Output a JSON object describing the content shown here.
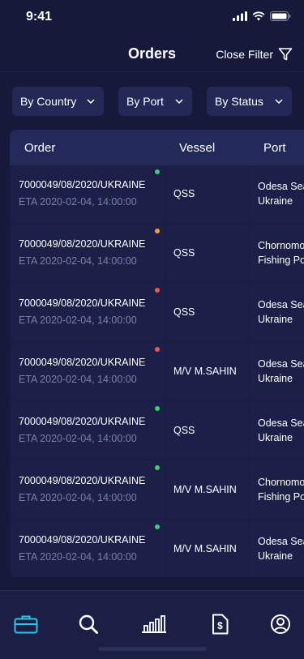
{
  "status_bar": {
    "time": "9:41"
  },
  "header": {
    "title": "Orders",
    "close_filter_label": "Close Filter"
  },
  "filters": [
    {
      "label": "By Country"
    },
    {
      "label": "By Port"
    },
    {
      "label": "By Status"
    }
  ],
  "table": {
    "columns": [
      "Order",
      "Vessel",
      "Port"
    ],
    "rows": [
      {
        "order_id": "7000049/08/2020/UKRAINE",
        "eta": "ETA 2020-02-04, 14:00:00",
        "vessel": "QSS",
        "port_line1": "Odesa Sea",
        "port_line2": "Ukraine",
        "status_color": "#3ccf6e"
      },
      {
        "order_id": "7000049/08/2020/UKRAINE",
        "eta": "ETA 2020-02-04, 14:00:00",
        "vessel": "QSS",
        "port_line1": "Chornomo",
        "port_line2": "Fishing Po",
        "status_color": "#f2994a"
      },
      {
        "order_id": "7000049/08/2020/UKRAINE",
        "eta": "ETA 2020-02-04, 14:00:00",
        "vessel": "QSS",
        "port_line1": "Odesa Sea",
        "port_line2": "Ukraine",
        "status_color": "#eb5757"
      },
      {
        "order_id": "7000049/08/2020/UKRAINE",
        "eta": "ETA 2020-02-04, 14:00:00",
        "vessel": "M/V M.SAHIN",
        "port_line1": "Odesa Sea",
        "port_line2": "Ukraine",
        "status_color": "#eb5757"
      },
      {
        "order_id": "7000049/08/2020/UKRAINE",
        "eta": "ETA 2020-02-04, 14:00:00",
        "vessel": "QSS",
        "port_line1": "Odesa Sea",
        "port_line2": "Ukraine",
        "status_color": "#3ccf6e"
      },
      {
        "order_id": "7000049/08/2020/UKRAINE",
        "eta": "ETA 2020-02-04, 14:00:00",
        "vessel": "M/V M.SAHIN",
        "port_line1": "Chornomo",
        "port_line2": "Fishing Po",
        "status_color": "#3ccf6e"
      },
      {
        "order_id": "7000049/08/2020/UKRAINE",
        "eta": "ETA 2020-02-04, 14:00:00",
        "vessel": "M/V M.SAHIN",
        "port_line1": "Odesa Sea",
        "port_line2": "Ukraine",
        "status_color": "#3ccf6e"
      }
    ]
  },
  "tab_bar": {
    "items": [
      {
        "icon": "briefcase-icon",
        "active": true
      },
      {
        "icon": "search-icon",
        "active": false
      },
      {
        "icon": "bar-chart-icon",
        "active": false
      },
      {
        "icon": "invoice-dollar-icon",
        "active": false
      },
      {
        "icon": "profile-icon",
        "active": false
      }
    ]
  },
  "colors": {
    "background": "#16193a",
    "accent": "#2ec4e6",
    "muted_text": "#7b80a8"
  }
}
